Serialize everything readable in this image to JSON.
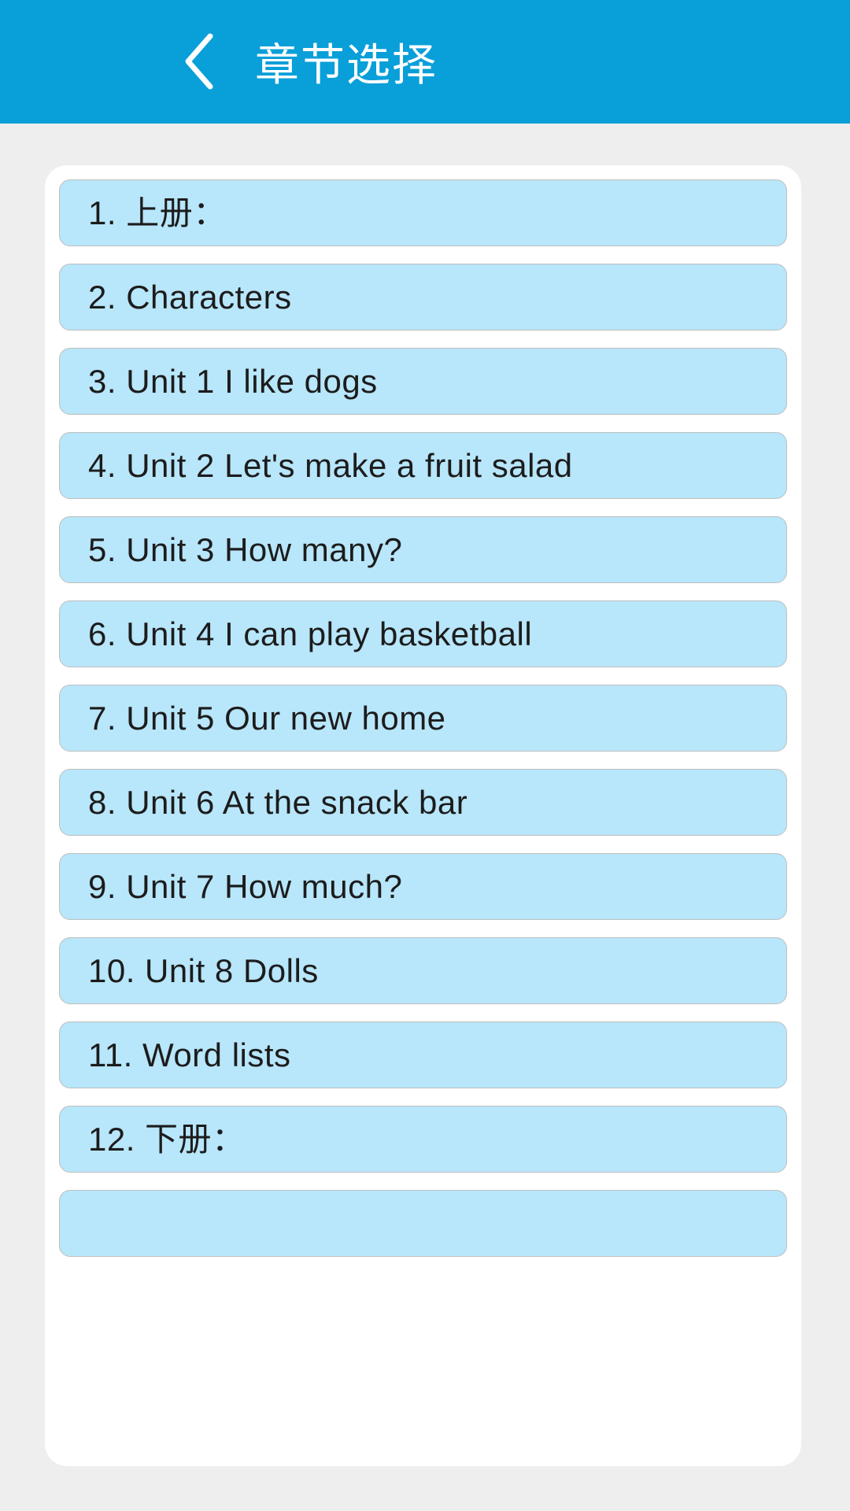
{
  "header": {
    "title": "章节选择",
    "back_icon": "chevron-left-icon",
    "background_color": "#099fd9",
    "text_color": "#ffffff"
  },
  "theme": {
    "page_background": "#efeeee",
    "card_background": "#ffffff",
    "item_background": "#b8e6fa",
    "item_border": "#bfbfbf",
    "item_text": "#1c1c1c"
  },
  "chapter_list": {
    "items": [
      {
        "label": "1. 上册："
      },
      {
        "label": "2. Characters"
      },
      {
        "label": "3. Unit 1 I like dogs"
      },
      {
        "label": "4. Unit 2 Let's make a fruit salad"
      },
      {
        "label": "5. Unit 3 How many?"
      },
      {
        "label": "6. Unit 4 I can play basketball"
      },
      {
        "label": "7. Unit 5 Our new home"
      },
      {
        "label": "8. Unit 6 At the snack bar"
      },
      {
        "label": "9. Unit 7 How much?"
      },
      {
        "label": "10. Unit 8 Dolls"
      },
      {
        "label": "11. Word lists"
      },
      {
        "label": "12. 下册："
      },
      {
        "label": ""
      }
    ]
  }
}
